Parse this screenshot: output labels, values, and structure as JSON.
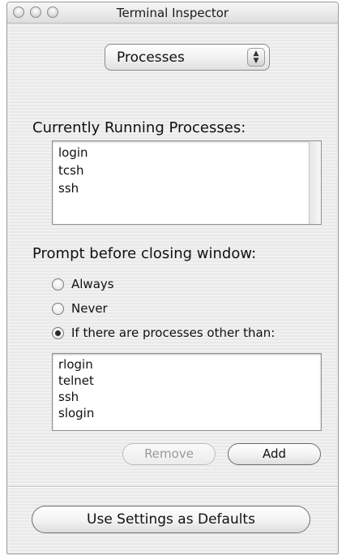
{
  "window": {
    "title": "Terminal Inspector"
  },
  "pane_selector": {
    "selected": "Processes"
  },
  "running": {
    "heading": "Currently Running Processes:",
    "items": [
      "login",
      "tcsh",
      "ssh"
    ]
  },
  "prompt": {
    "heading": "Prompt before closing window:",
    "options": [
      {
        "label": "Always",
        "checked": false
      },
      {
        "label": "Never",
        "checked": false
      },
      {
        "label": "If there are processes other than:",
        "checked": true
      }
    ]
  },
  "exceptions": {
    "items": [
      "rlogin",
      "telnet",
      "ssh",
      "slogin"
    ]
  },
  "buttons": {
    "remove": "Remove",
    "add": "Add",
    "defaults": "Use Settings as Defaults"
  },
  "icons": {
    "close": "close-icon",
    "minimize": "minimize-icon",
    "zoom": "zoom-icon",
    "popup_arrows": "up-down-arrows-icon"
  }
}
